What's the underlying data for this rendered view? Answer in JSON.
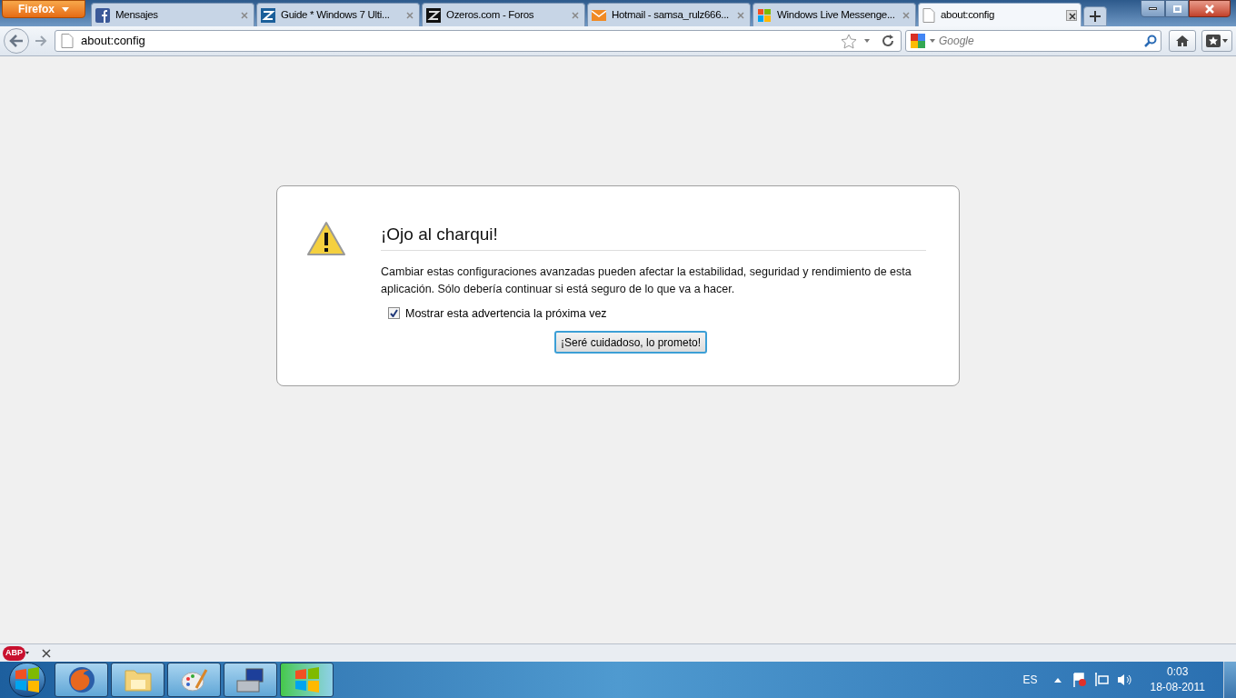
{
  "browser": {
    "menu_button": "Firefox",
    "tabs": [
      {
        "title": "Mensajes",
        "kind": "facebook",
        "selected": false
      },
      {
        "title": "Guide * Windows 7 Ulti...",
        "kind": "zeta",
        "selected": false
      },
      {
        "title": "Ozeros.com - Foros",
        "kind": "zeta-dark",
        "selected": false
      },
      {
        "title": "Hotmail - samsa_rulz666...",
        "kind": "mail",
        "selected": false
      },
      {
        "title": "Windows Live Messenge...",
        "kind": "windows",
        "selected": false
      },
      {
        "title": "about:config",
        "kind": "page",
        "selected": true
      }
    ],
    "url": "about:config",
    "search_placeholder": "Google"
  },
  "dialog": {
    "title": "¡Ojo al charqui!",
    "message": "Cambiar estas configuraciones avanzadas pueden afectar la estabilidad, seguridad y rendimiento de esta aplicación. Sólo debería continuar si está seguro de lo que va a hacer.",
    "checkbox": {
      "label": "Mostrar esta advertencia la próxima vez",
      "checked": true
    },
    "button": "¡Seré cuidadoso, lo prometo!"
  },
  "addon_bar": {
    "badge": "ABP"
  },
  "taskbar": {
    "apps": [
      {
        "kind": "firefox"
      },
      {
        "kind": "folder"
      },
      {
        "kind": "paint"
      },
      {
        "kind": "computer"
      },
      {
        "kind": "windows"
      }
    ],
    "language": "ES",
    "time": "0:03",
    "date": "18-08-2011"
  }
}
